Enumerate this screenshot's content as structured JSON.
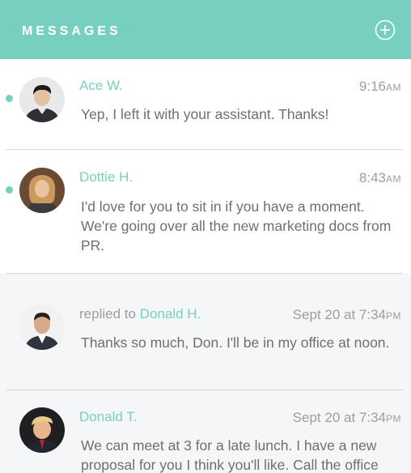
{
  "header": {
    "title": "MESSAGES",
    "add_icon": "plus-circle-icon",
    "background": "#77d0bf"
  },
  "messages": [
    {
      "status": "unread",
      "name": "Ace W.",
      "time": "9:16",
      "ampm": "AM",
      "text": "Yep, I left it with your assistant. Thanks!"
    },
    {
      "status": "unread",
      "name": "Dottie H.",
      "time": "8:43",
      "ampm": "AM",
      "text": "I'd love for you to sit in if you have a moment. We're going over all the new marketing docs from PR."
    },
    {
      "status": "read",
      "prefix": "replied to ",
      "name": "Donald H.",
      "time": "Sept 20 at 7:34",
      "ampm": "PM",
      "text": "Thanks so much, Don.  I'll be in my office at noon."
    },
    {
      "status": "read",
      "name": "Donald T.",
      "time": "Sept 20 at 7:34",
      "ampm": "PM",
      "text": "We can meet at 3 for a late lunch.  I have a new proposal for you I think you'll like.  Call the office"
    }
  ],
  "colors": {
    "accent": "#77d0bf",
    "text": "#6d6f72",
    "muted": "#9b9d9f"
  }
}
